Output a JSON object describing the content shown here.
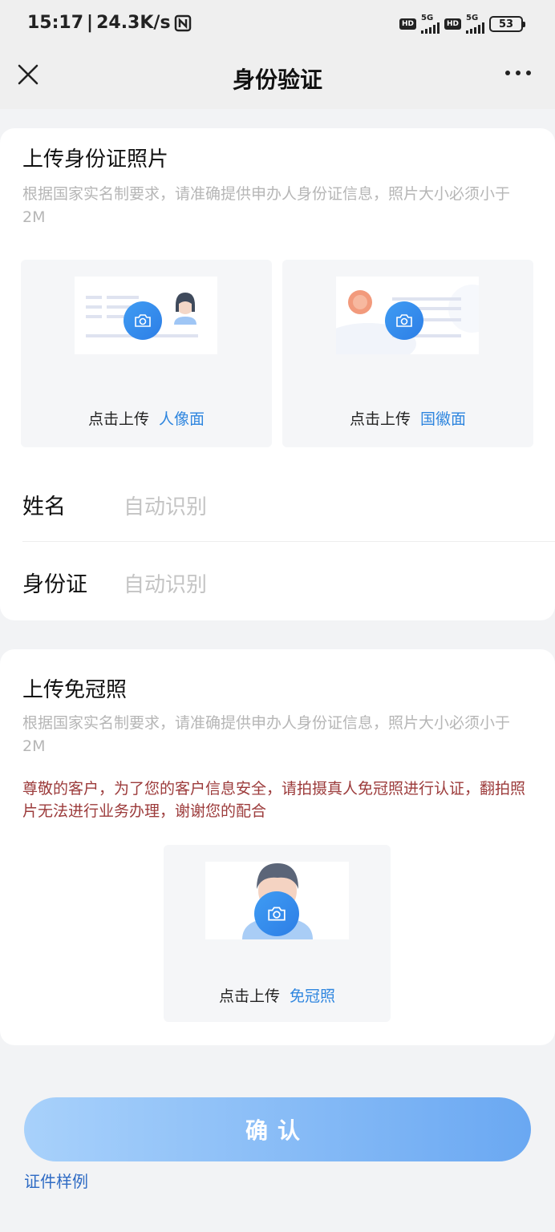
{
  "status_bar": {
    "time": "15:17",
    "speed": "24.3K/s",
    "hd_label": "HD",
    "net_label": "5G",
    "battery": "53"
  },
  "nav": {
    "title": "身份验证"
  },
  "id_section": {
    "title": "上传身份证照片",
    "subtitle": "根据国家实名制要求，请准确提供申办人身份证信息，照片大小必须小于2M",
    "upload_prefix": "点击上传",
    "front_label": "人像面",
    "back_label": "国徽面"
  },
  "fields": {
    "name_label": "姓名",
    "name_placeholder": "自动识别",
    "id_label": "身份证",
    "id_placeholder": "自动识别"
  },
  "photo_section": {
    "title": "上传免冠照",
    "subtitle": "根据国家实名制要求，请准确提供申办人身份证信息，照片大小必须小于2M",
    "warning": "尊敬的客户，为了您的客户信息安全，请拍摄真人免冠照进行认证，翻拍照片无法进行业务办理，谢谢您的配合",
    "upload_prefix": "点击上传",
    "photo_label": "免冠照"
  },
  "actions": {
    "confirm_label": "确认",
    "sample_link": "证件样例"
  },
  "colors": {
    "accent": "#2f86df",
    "warning": "#9c3b3b",
    "button_gradient_start": "#a8d1fb",
    "button_gradient_end": "#6aa8f2"
  }
}
